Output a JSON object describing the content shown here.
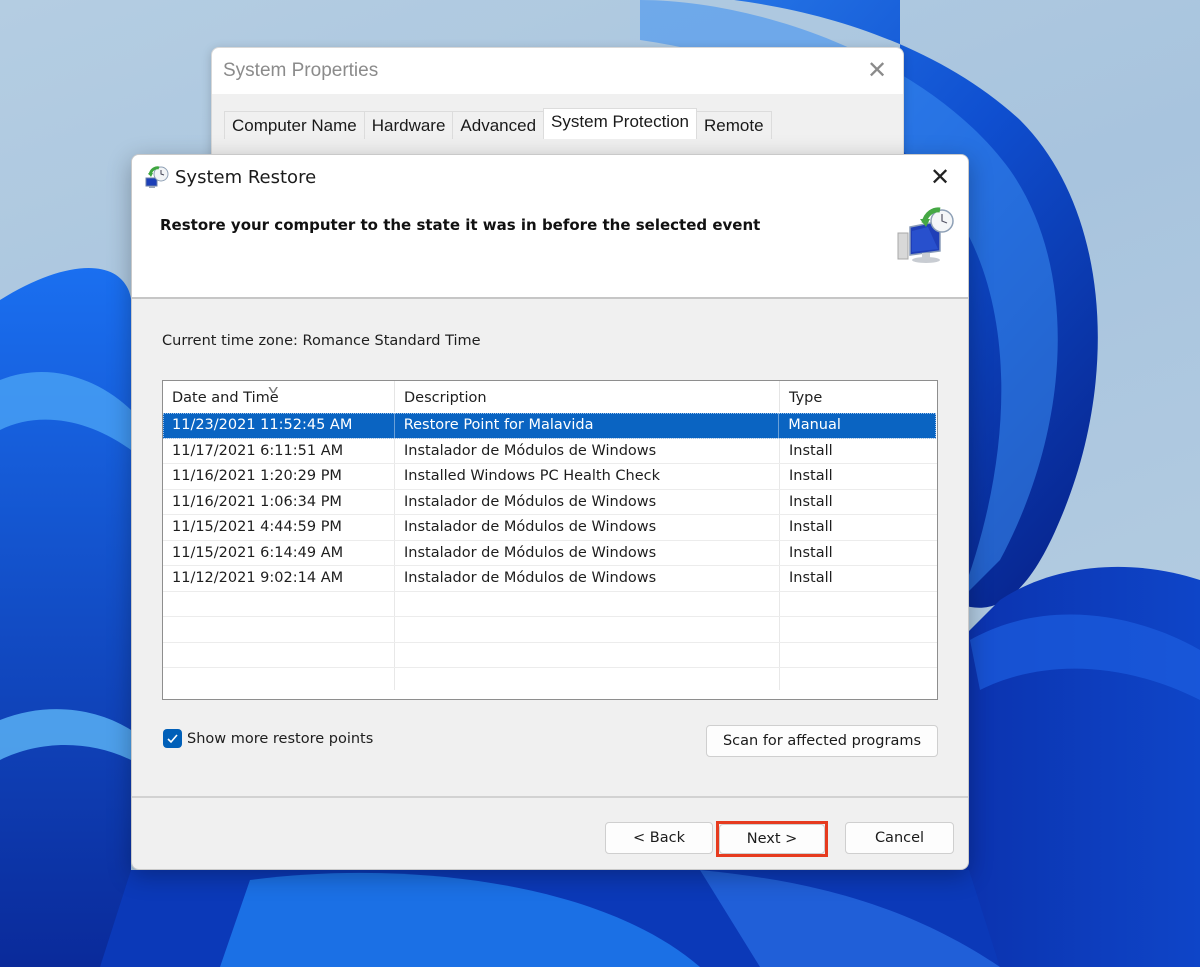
{
  "background_window": {
    "title": "System Properties",
    "close_glyph": "✕",
    "tabs": [
      {
        "label": "Computer Name",
        "active": false
      },
      {
        "label": "Hardware",
        "active": false
      },
      {
        "label": "Advanced",
        "active": false
      },
      {
        "label": "System Protection",
        "active": true
      },
      {
        "label": "Remote",
        "active": false
      }
    ]
  },
  "dialog": {
    "title": "System Restore",
    "app_icon": "system-restore-icon",
    "close_glyph": "✕",
    "heading": "Restore your computer to the state it was in before the selected event",
    "header_graphic": "system-restore-graphic",
    "timezone_label": "Current time zone: Romance Standard Time",
    "list": {
      "columns": [
        "Date and Time",
        "Description",
        "Type"
      ],
      "sorted_column": "Date and Time",
      "sort_glyph": "v",
      "selected_index": 0,
      "rows": [
        {
          "date": "11/23/2021 11:52:45 AM",
          "description": "Restore Point for Malavida",
          "type": "Manual"
        },
        {
          "date": "11/17/2021 6:11:51 AM",
          "description": "Instalador de Módulos de Windows",
          "type": "Install"
        },
        {
          "date": "11/16/2021 1:20:29 PM",
          "description": "Installed Windows PC Health Check",
          "type": "Install"
        },
        {
          "date": "11/16/2021 1:06:34 PM",
          "description": "Instalador de Módulos de Windows",
          "type": "Install"
        },
        {
          "date": "11/15/2021 4:44:59 PM",
          "description": "Instalador de Módulos de Windows",
          "type": "Install"
        },
        {
          "date": "11/15/2021 6:14:49 AM",
          "description": "Instalador de Módulos de Windows",
          "type": "Install"
        },
        {
          "date": "11/12/2021 9:02:14 AM",
          "description": "Instalador de Módulos de Windows",
          "type": "Install"
        }
      ],
      "empty_rows": 4
    },
    "show_more_checkbox": {
      "label": "Show more restore points",
      "checked": true
    },
    "scan_button": "Scan for affected programs",
    "buttons": {
      "back": "< Back",
      "next": "Next >",
      "cancel": "Cancel"
    },
    "annotation": {
      "target": "next",
      "color": "#e63b1f"
    }
  },
  "colors": {
    "selection": "#0a64c2",
    "checkbox": "#005fb8",
    "highlight": "#e63b1f"
  }
}
